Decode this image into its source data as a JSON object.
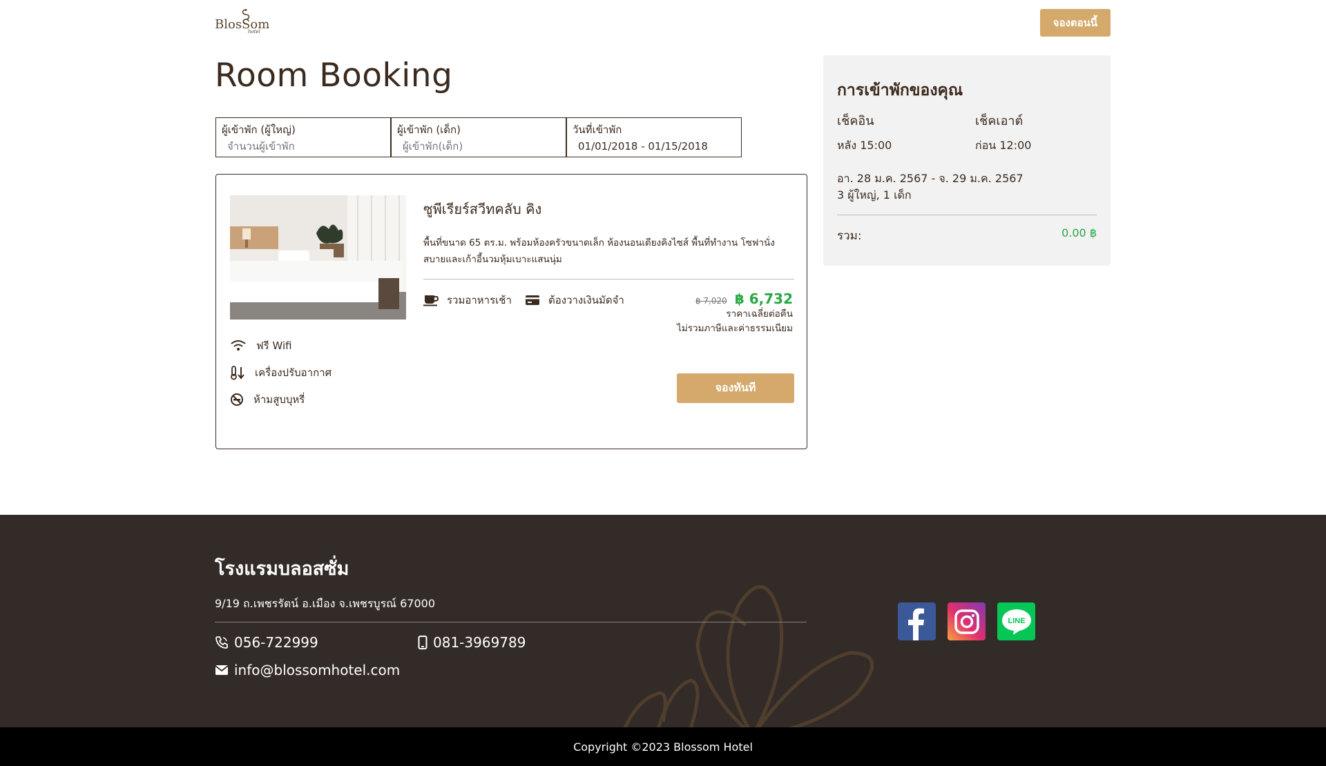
{
  "header": {
    "logo_text": "BlosSom",
    "logo_sub": "hotel",
    "book_now_label": "จองตอนนี้"
  },
  "page_title": "Room Booking",
  "filters": {
    "adults_label": "ผู้เข้าพัก (ผู้ใหญ่)",
    "adults_placeholder": "จำนวนผู้เข้าพัก",
    "children_label": "ผู้เข้าพัก (เด็ก)",
    "children_placeholder": "ผู้เข้าพัก(เด็ก)",
    "date_label": "วันที่เข้าพัก",
    "date_value": "01/01/2018 - 01/15/2018"
  },
  "room": {
    "name": "ซูพีเรียร์สวีทคลับ คิง",
    "description": "พื้นที่ขนาด 65 ตร.ม. พร้อมห้องครัวขนาดเล็ก ห้องนอนเตียงคิงไซส์ พื้นที่ทำงาน โซฟานั่งสบายและเก้าอี้นวมหุ้มเบาะแสนนุ่ม",
    "amenities": [
      {
        "icon": "wifi-icon",
        "label": "ฟรี Wifi"
      },
      {
        "icon": "thermometer-icon",
        "label": "เครื่องปรับอากาศ"
      },
      {
        "icon": "no-smoking-icon",
        "label": "ห้ามสูบบุหรี่"
      }
    ],
    "perks": [
      {
        "icon": "coffee-cup-icon",
        "label": "รวมอาหารเช้า"
      },
      {
        "icon": "credit-card-icon",
        "label": "ต้องวางเงินมัดจำ"
      }
    ],
    "old_price": "฿ 7,020",
    "new_price": "฿ 6,732",
    "price_note_1": "ราคาเฉลี่ยต่อคืน",
    "price_note_2": "ไม่รวมภาษีและค่าธรรมเนียม",
    "book_label": "จองทันที"
  },
  "summary": {
    "title": "การเข้าพักของคุณ",
    "checkin_label": "เช็คอิน",
    "checkin_value": "หลัง 15:00",
    "checkout_label": "เช็คเอาต์",
    "checkout_value": "ก่อน 12:00",
    "dates": "อา. 28 ม.ค. 2567 - จ. 29 ม.ค. 2567",
    "guests": "3 ผู้ใหญ่, 1 เด็ก",
    "total_label": "รวม:",
    "total_value": "0.00 ฿"
  },
  "footer": {
    "hotel_name": "โรงแรมบลอสซั่ม",
    "address": "9/19 ถ.เพชรรัตน์ อ.เมือง จ.เพชรบูรณ์ 67000",
    "phone": "056-722999",
    "mobile": "081-3969789",
    "email": "info@blossomhotel.com",
    "social": [
      {
        "icon": "facebook-icon",
        "color": "#3b5998"
      },
      {
        "icon": "instagram-icon",
        "color": "#c13584"
      },
      {
        "icon": "line-icon",
        "color": "#06c755",
        "text": "LINE"
      }
    ],
    "copyright": "Copyright ©2023 Blossom Hotel"
  },
  "colors": {
    "accent": "#d4a96b",
    "text_dark": "#3b2a1e",
    "price_green": "#28a745",
    "footer_bg": "#332b27"
  }
}
